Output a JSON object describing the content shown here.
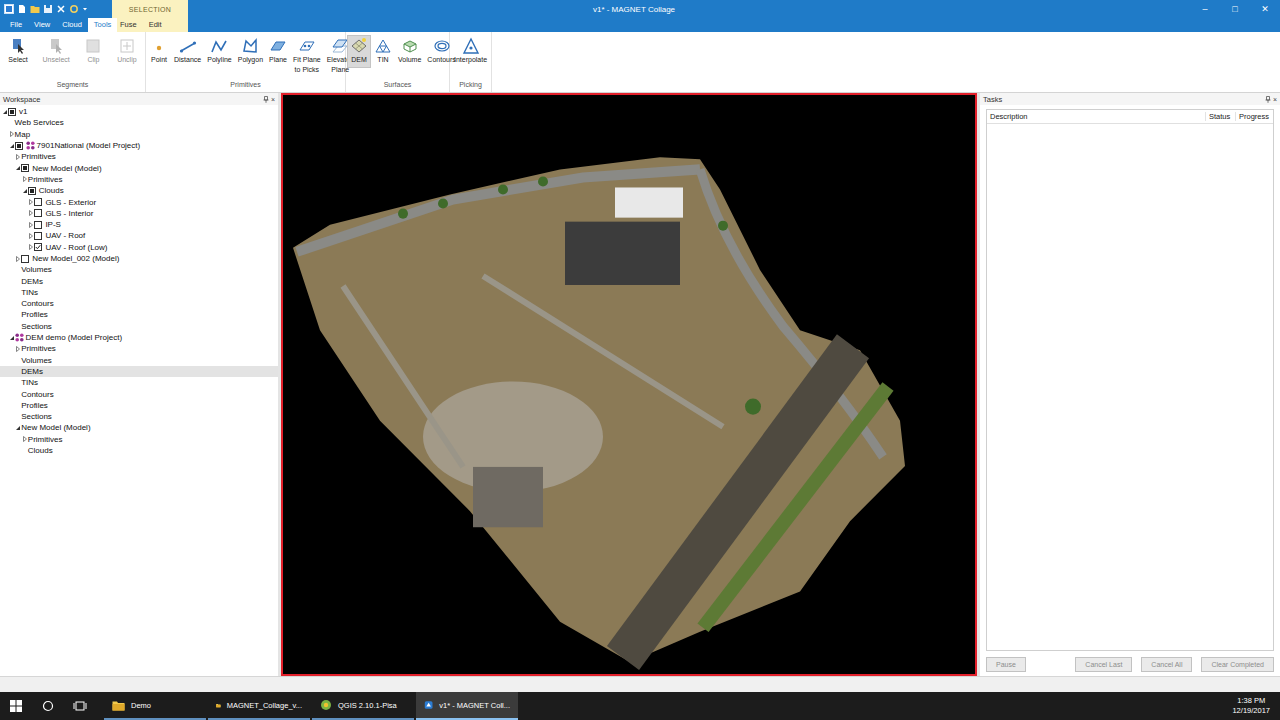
{
  "window": {
    "title": "v1* - MAGNET Collage",
    "controls": [
      "–",
      "□",
      "✕"
    ]
  },
  "ribbon": {
    "tabs": [
      {
        "label": "File",
        "selected": false
      },
      {
        "label": "View",
        "selected": false
      },
      {
        "label": "Cloud",
        "selected": false
      },
      {
        "label": "Tools",
        "selected": true
      }
    ],
    "context_group": {
      "label": "SELECTION",
      "tabs": [
        {
          "label": "Fuse",
          "selected": false
        },
        {
          "label": "Edit",
          "selected": false
        }
      ]
    },
    "groups": [
      {
        "label": "Segments",
        "buttons": [
          {
            "lines": [
              "Select"
            ],
            "disabled": false,
            "hovered": false
          },
          {
            "lines": [
              "Unselect"
            ],
            "disabled": true,
            "hovered": false
          },
          {
            "lines": [
              "Clip"
            ],
            "disabled": true,
            "hovered": false
          },
          {
            "lines": [
              "Unclip"
            ],
            "disabled": true,
            "hovered": false
          }
        ]
      },
      {
        "label": "Primitives",
        "buttons": [
          {
            "lines": [
              "Point"
            ],
            "disabled": false,
            "hovered": false
          },
          {
            "lines": [
              "Distance"
            ],
            "disabled": false,
            "hovered": false
          },
          {
            "lines": [
              "Polyline"
            ],
            "disabled": false,
            "hovered": false
          },
          {
            "lines": [
              "Polygon"
            ],
            "disabled": false,
            "hovered": false
          },
          {
            "lines": [
              "Plane"
            ],
            "disabled": false,
            "hovered": false
          },
          {
            "lines": [
              "Fit Plane",
              "to Picks"
            ],
            "disabled": false,
            "hovered": false
          },
          {
            "lines": [
              "Elevated",
              "Plane"
            ],
            "disabled": false,
            "hovered": false
          }
        ]
      },
      {
        "label": "Surfaces",
        "buttons": [
          {
            "lines": [
              "DEM"
            ],
            "disabled": false,
            "hovered": true
          },
          {
            "lines": [
              "TIN"
            ],
            "disabled": false,
            "hovered": false
          },
          {
            "lines": [
              "Volume"
            ],
            "disabled": false,
            "hovered": false
          },
          {
            "lines": [
              "Contours"
            ],
            "disabled": false,
            "hovered": false
          }
        ]
      },
      {
        "label": "Picking",
        "buttons": [
          {
            "lines": [
              "Interpolate"
            ],
            "disabled": false,
            "hovered": false
          }
        ]
      }
    ]
  },
  "workspace": {
    "title": "Workspace",
    "close": "×",
    "items": [
      {
        "label": "v1",
        "level": 0,
        "expandable": true,
        "expanded": true,
        "check": "partial",
        "kind": "node",
        "selected": false
      },
      {
        "label": "Web Services",
        "level": 1,
        "expandable": false,
        "expanded": false,
        "check": "none",
        "kind": "node",
        "selected": false
      },
      {
        "label": "Map",
        "level": 1,
        "expandable": true,
        "expanded": false,
        "check": "none",
        "kind": "node",
        "selected": false
      },
      {
        "label": "7901National (Model Project)",
        "level": 1,
        "expandable": true,
        "expanded": true,
        "check": "partial",
        "kind": "project",
        "selected": false
      },
      {
        "label": "Primitives",
        "level": 2,
        "expandable": true,
        "expanded": false,
        "check": "none",
        "kind": "node",
        "selected": false
      },
      {
        "label": "New Model (Model)",
        "level": 2,
        "expandable": true,
        "expanded": true,
        "check": "partial",
        "kind": "node",
        "selected": false
      },
      {
        "label": "Primitives",
        "level": 3,
        "expandable": true,
        "expanded": false,
        "check": "none",
        "kind": "node",
        "selected": false
      },
      {
        "label": "Clouds",
        "level": 3,
        "expandable": true,
        "expanded": true,
        "check": "partial",
        "kind": "node",
        "selected": false
      },
      {
        "label": "GLS - Exterior",
        "level": 4,
        "expandable": true,
        "expanded": false,
        "check": "unchecked",
        "kind": "node",
        "selected": false
      },
      {
        "label": "GLS - Interior",
        "level": 4,
        "expandable": true,
        "expanded": false,
        "check": "unchecked",
        "kind": "node",
        "selected": false
      },
      {
        "label": "IP-S",
        "level": 4,
        "expandable": true,
        "expanded": false,
        "check": "unchecked",
        "kind": "node",
        "selected": false
      },
      {
        "label": "UAV - Roof",
        "level": 4,
        "expandable": true,
        "expanded": false,
        "check": "unchecked",
        "kind": "node",
        "selected": false
      },
      {
        "label": "UAV - Roof (Low)",
        "level": 4,
        "expandable": true,
        "expanded": false,
        "check": "checked",
        "kind": "node",
        "selected": false
      },
      {
        "label": "New Model_002 (Model)",
        "level": 2,
        "expandable": true,
        "expanded": false,
        "check": "unchecked",
        "kind": "node",
        "selected": false
      },
      {
        "label": "Volumes",
        "level": 2,
        "expandable": false,
        "expanded": false,
        "check": "none",
        "kind": "node",
        "selected": false
      },
      {
        "label": "DEMs",
        "level": 2,
        "expandable": false,
        "expanded": false,
        "check": "none",
        "kind": "node",
        "selected": false
      },
      {
        "label": "TINs",
        "level": 2,
        "expandable": false,
        "expanded": false,
        "check": "none",
        "kind": "node",
        "selected": false
      },
      {
        "label": "Contours",
        "level": 2,
        "expandable": false,
        "expanded": false,
        "check": "none",
        "kind": "node",
        "selected": false
      },
      {
        "label": "Profiles",
        "level": 2,
        "expandable": false,
        "expanded": false,
        "check": "none",
        "kind": "node",
        "selected": false
      },
      {
        "label": "Sections",
        "level": 2,
        "expandable": false,
        "expanded": false,
        "check": "none",
        "kind": "node",
        "selected": false
      },
      {
        "label": "DEM demo (Model Project)",
        "level": 1,
        "expandable": true,
        "expanded": true,
        "check": "none",
        "kind": "project",
        "selected": false
      },
      {
        "label": "Primitives",
        "level": 2,
        "expandable": true,
        "expanded": false,
        "check": "none",
        "kind": "node",
        "selected": false
      },
      {
        "label": "Volumes",
        "level": 2,
        "expandable": false,
        "expanded": false,
        "check": "none",
        "kind": "node",
        "selected": false
      },
      {
        "label": "DEMs",
        "level": 2,
        "expandable": false,
        "expanded": false,
        "check": "none",
        "kind": "node",
        "selected": true
      },
      {
        "label": "TINs",
        "level": 2,
        "expandable": false,
        "expanded": false,
        "check": "none",
        "kind": "node",
        "selected": false
      },
      {
        "label": "Contours",
        "level": 2,
        "expandable": false,
        "expanded": false,
        "check": "none",
        "kind": "node",
        "selected": false
      },
      {
        "label": "Profiles",
        "level": 2,
        "expandable": false,
        "expanded": false,
        "check": "none",
        "kind": "node",
        "selected": false
      },
      {
        "label": "Sections",
        "level": 2,
        "expandable": false,
        "expanded": false,
        "check": "none",
        "kind": "node",
        "selected": false
      },
      {
        "label": "New Model (Model)",
        "level": 2,
        "expandable": true,
        "expanded": true,
        "check": "none",
        "kind": "node",
        "selected": false
      },
      {
        "label": "Primitives",
        "level": 3,
        "expandable": true,
        "expanded": false,
        "check": "none",
        "kind": "node",
        "selected": false
      },
      {
        "label": "Clouds",
        "level": 3,
        "expandable": false,
        "expanded": false,
        "check": "none",
        "kind": "node",
        "selected": false
      }
    ]
  },
  "viewport": {
    "focused": true
  },
  "tasks": {
    "title": "Tasks",
    "close": "×",
    "columns": [
      "Description",
      "Status",
      "Progress"
    ],
    "rows": [],
    "buttons": [
      {
        "label": "Pause",
        "disabled": true
      },
      {
        "label": "Cancel Last",
        "disabled": true
      },
      {
        "label": "Cancel All",
        "disabled": true
      },
      {
        "label": "Clear Completed",
        "disabled": true
      }
    ]
  },
  "taskbar": {
    "items": [
      {
        "label": "Demo",
        "active": false
      },
      {
        "label": "MAGNET_Collage_v...",
        "active": false
      },
      {
        "label": "QGIS 2.10.1-Pisa",
        "active": false
      },
      {
        "label": "v1* - MAGNET Coll...",
        "active": true
      }
    ],
    "time": "1:38 PM",
    "date": "12/19/2017"
  }
}
